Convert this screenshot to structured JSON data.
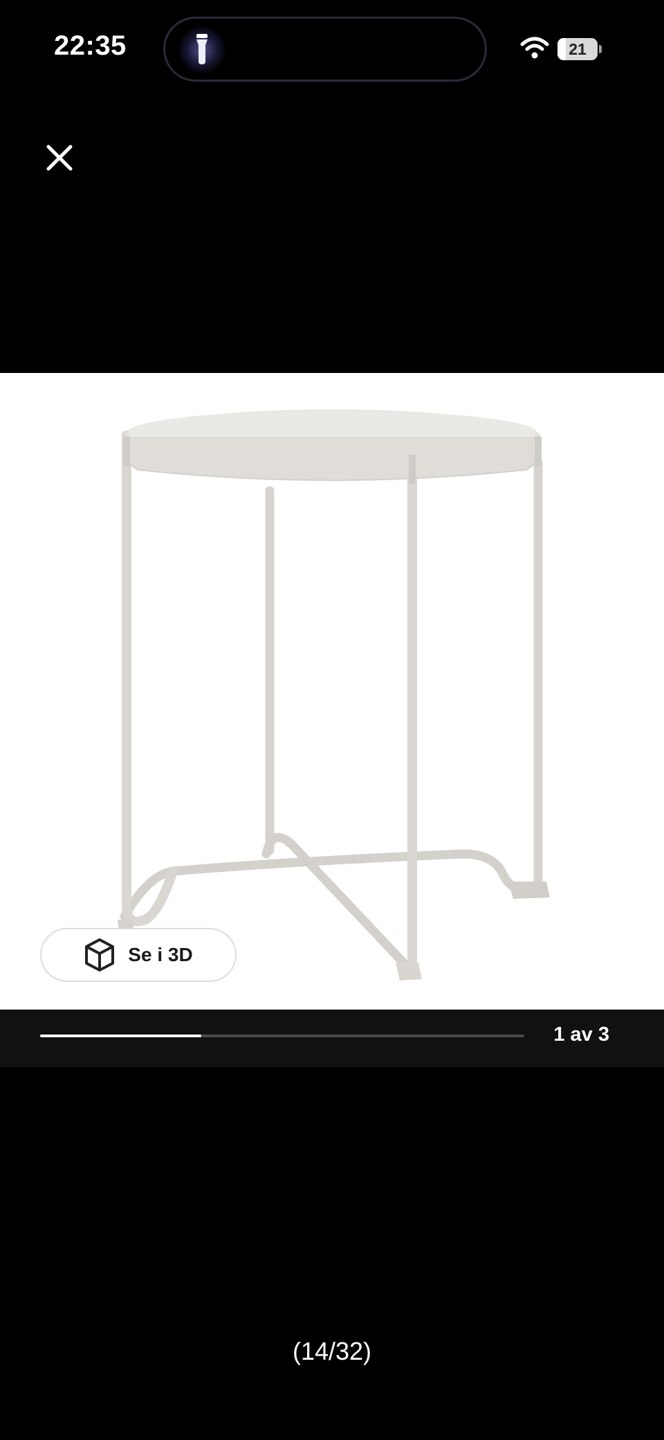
{
  "status_bar": {
    "time": "22:35",
    "battery_level": "21",
    "battery_fraction": 0.21,
    "icons": [
      "flashlight-icon",
      "wifi-icon",
      "battery-icon"
    ]
  },
  "viewer": {
    "close_icon": "close-icon",
    "view_3d": {
      "label": "Se i 3D",
      "icon": "cube-icon"
    },
    "image_progress": {
      "counter": "1 av 3",
      "current": 1,
      "total": 3
    },
    "page_counter": "(14/32)"
  },
  "colors": {
    "background": "#000000",
    "stage": "#ffffff",
    "strip": "#111111",
    "accent": "#ffffff"
  }
}
